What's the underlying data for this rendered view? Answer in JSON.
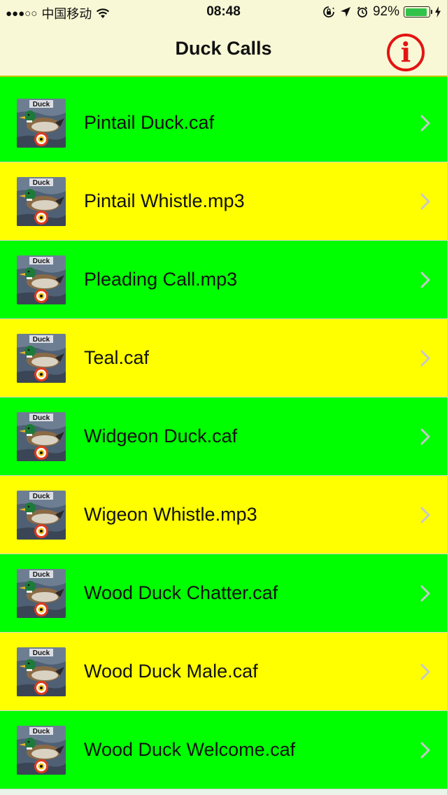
{
  "status_bar": {
    "signal": "●●●○○",
    "carrier": "中国移动",
    "time": "08:48",
    "battery": "92%",
    "battery_level": 0.92,
    "icons": [
      "wifi-icon",
      "rotation-lock-icon",
      "location-arrow-icon",
      "alarm-icon",
      "battery-icon",
      "charging-icon"
    ]
  },
  "nav": {
    "title": "Duck Calls",
    "info_glyph": "i",
    "info_color": "#e31414"
  },
  "colors": {
    "green_row": "#00ff00",
    "yellow_row": "#ffff00",
    "header_bg": "#f8f8d6"
  },
  "list": {
    "thumbnail_label": "Duck",
    "items": [
      {
        "label": "Pintail Duck.caf",
        "color": "green"
      },
      {
        "label": "Pintail Whistle.mp3",
        "color": "yellow"
      },
      {
        "label": "Pleading Call.mp3",
        "color": "green"
      },
      {
        "label": "Teal.caf",
        "color": "yellow"
      },
      {
        "label": "Widgeon Duck.caf",
        "color": "green"
      },
      {
        "label": "Wigeon Whistle.mp3",
        "color": "yellow"
      },
      {
        "label": "Wood Duck Chatter.caf",
        "color": "green"
      },
      {
        "label": "Wood Duck Male.caf",
        "color": "yellow"
      },
      {
        "label": "Wood Duck Welcome.caf",
        "color": "green"
      }
    ]
  }
}
